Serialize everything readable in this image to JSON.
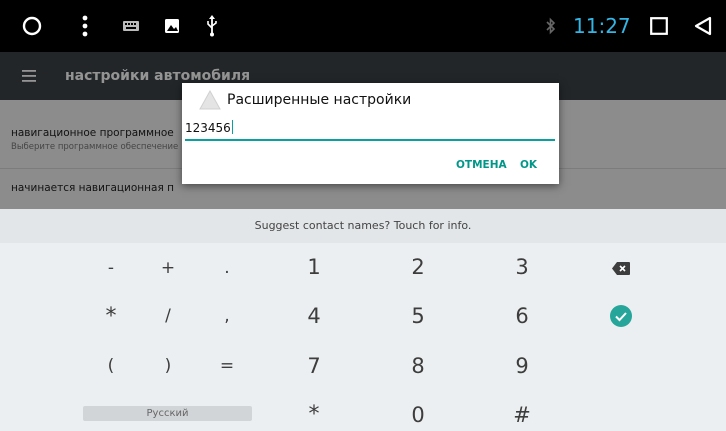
{
  "status_bar": {
    "time": "11:27",
    "icons": [
      "circle-home-icon",
      "overflow-dots-icon",
      "keyboard-icon",
      "image-icon",
      "usb-icon",
      "bluetooth-icon",
      "square-recents-icon",
      "triangle-back-icon"
    ]
  },
  "app": {
    "title": "настройки автомобиля",
    "items": [
      {
        "title": "навигационное программное",
        "subtitle": "Выберите программное обеспечение"
      },
      {
        "title": "начинается навигационная п"
      }
    ]
  },
  "dialog": {
    "title": "Расширенные настройки",
    "input_value": "123456",
    "cancel_label": "ОТМЕНА",
    "ok_label": "OK",
    "accent": "#009688"
  },
  "keyboard": {
    "suggestion": "Suggest contact names? Touch for info.",
    "rows": [
      [
        "-",
        "+",
        ".",
        "1",
        "2",
        "3"
      ],
      [
        "*",
        "/",
        ",",
        "4",
        "5",
        "6"
      ],
      [
        "(",
        ")",
        "=",
        "7",
        "8",
        "9"
      ],
      [
        "*",
        "0",
        "#"
      ]
    ],
    "language_label": "Русский",
    "enter_color": "#26a69a"
  }
}
